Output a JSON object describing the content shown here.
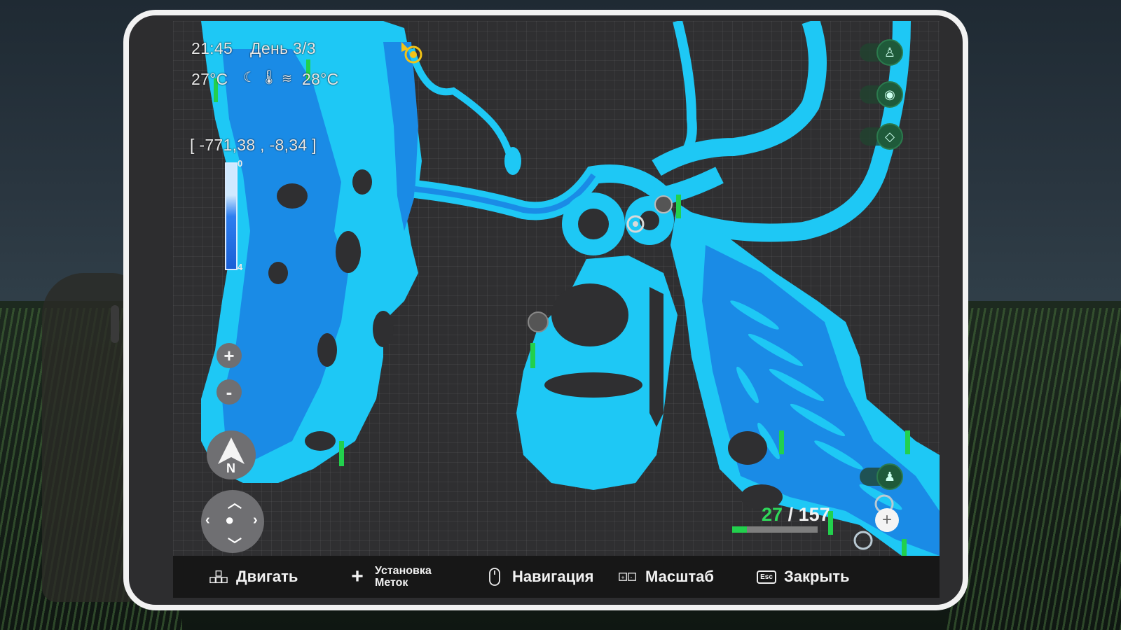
{
  "hud": {
    "time": "21:45",
    "day": "День 3/3",
    "air_temp": "27°C",
    "water_temp": "28°C",
    "coordinates": "[ -771,38 , -8,34 ]",
    "depth_top": "0",
    "depth_bottom": "4"
  },
  "zoom": {
    "in_label": "+",
    "out_label": "-"
  },
  "compass": {
    "label": "N"
  },
  "counter": {
    "current": "27",
    "separator": "/",
    "total": "157",
    "progress": 0.172
  },
  "bottom_bar": {
    "move_label": "Двигать",
    "markers_line1": "Установка",
    "markers_line2": "Меток",
    "navigation_label": "Навигация",
    "scale_label": "Масштаб",
    "esc_key": "Esc",
    "close_label": "Закрыть"
  },
  "colors": {
    "water_shallow": "#1ec8f5",
    "water_deep": "#1a8be6",
    "land": "#2f2f31",
    "accent_green": "#22d04d",
    "marker_yellow": "#f3c316"
  },
  "icons": [
    "player-marker-icon",
    "rod-marker-icon",
    "fisher-icon",
    "compass-north-icon",
    "map-pin-icon",
    "diamond-icon",
    "plus-icon"
  ]
}
